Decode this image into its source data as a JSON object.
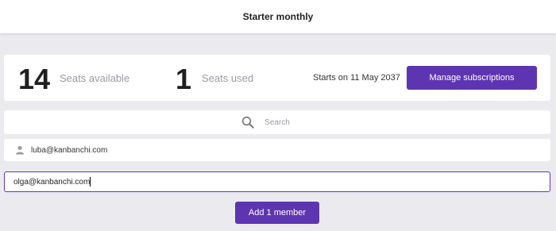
{
  "header": {
    "title": "Starter monthly"
  },
  "stats": {
    "seats_available_count": "14",
    "seats_available_label": "Seats available",
    "seats_used_count": "1",
    "seats_used_label": "Seats used",
    "starts_text": "Starts on 11 May 2037",
    "manage_button_label": "Manage subscriptions"
  },
  "search": {
    "placeholder": "Search",
    "icon": "search-icon"
  },
  "members": [
    {
      "email": "luba@kanbanchi.com",
      "icon": "user-icon"
    }
  ],
  "new_member": {
    "value": "olga@kanbanchi.com"
  },
  "add_button_label": "Add 1 member",
  "colors": {
    "accent": "#5e35b1",
    "background": "#ebebef",
    "card": "#ffffff"
  }
}
